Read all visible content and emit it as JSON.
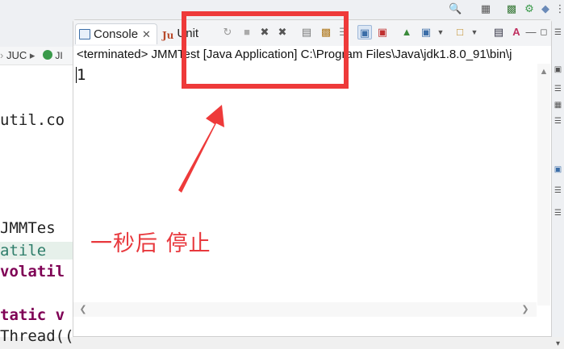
{
  "console_view": {
    "tabs": [
      {
        "label": "Console",
        "icon": "console-icon",
        "active": true
      },
      {
        "label": "JUnit",
        "icon_text": "Ju",
        "label_text": "Unit",
        "active": false
      }
    ],
    "status_line": "<terminated> JMMTest [Java Application] C:\\Program Files\\Java\\jdk1.8.0_91\\bin\\j",
    "output": "1"
  },
  "editor": {
    "breadcrumb": "JUC",
    "code_lines": [
      {
        "text": "util.co",
        "style": "plain"
      },
      {
        "text": " JMMTes",
        "style": "plain"
      },
      {
        "text": "atile",
        "style": "green"
      },
      {
        "text": "volatil",
        "style": "keyword"
      },
      {
        "text": "tatic v",
        "style": "keyword"
      },
      {
        "text": "Thread(() ->{",
        "style": "plain"
      }
    ]
  },
  "annotation": {
    "text": "一秒后 停止",
    "color": "#ee3a3a"
  },
  "colors": {
    "accent": "#3c6ea8",
    "annotation_red": "#ee3a3a"
  }
}
